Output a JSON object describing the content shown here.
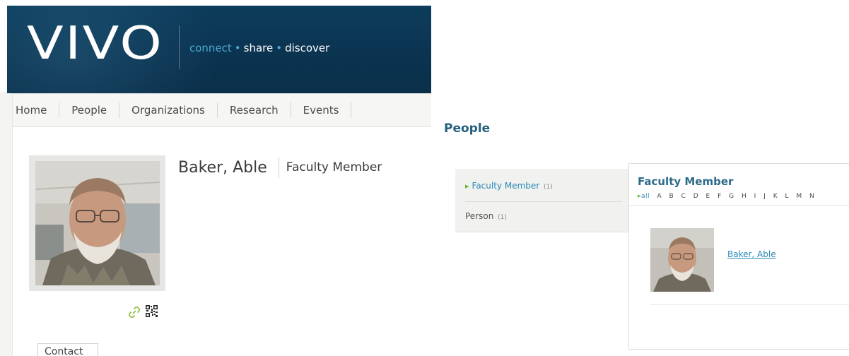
{
  "site": {
    "logo": "VIVO",
    "tagline": {
      "part1": "connect",
      "part2": "share",
      "part3": "discover",
      "separator": "•"
    }
  },
  "nav": {
    "items": [
      "Home",
      "People",
      "Organizations",
      "Research",
      "Events"
    ]
  },
  "profile": {
    "name": "Baker, Able",
    "type": "Faculty Member",
    "contact_tab": "Contact",
    "icons": [
      "link-icon",
      "qr-code-icon"
    ]
  },
  "browse": {
    "heading": "People",
    "classes": [
      {
        "label": "Faculty Member",
        "count": "(1)",
        "selected": true
      },
      {
        "label": "Person",
        "count": "(1)",
        "selected": false
      }
    ],
    "results_title": "Faculty Member",
    "alpha": {
      "selected": "all",
      "letters": [
        "A",
        "B",
        "C",
        "D",
        "E",
        "F",
        "G",
        "H",
        "I",
        "J",
        "K",
        "L",
        "M",
        "N"
      ]
    },
    "results": [
      {
        "label": "Baker, Able"
      }
    ]
  },
  "colors": {
    "banner": "#0b3552",
    "accent_blue": "#2a8ab8",
    "heading_blue": "#25607f",
    "accent_green": "#6cb33f"
  }
}
